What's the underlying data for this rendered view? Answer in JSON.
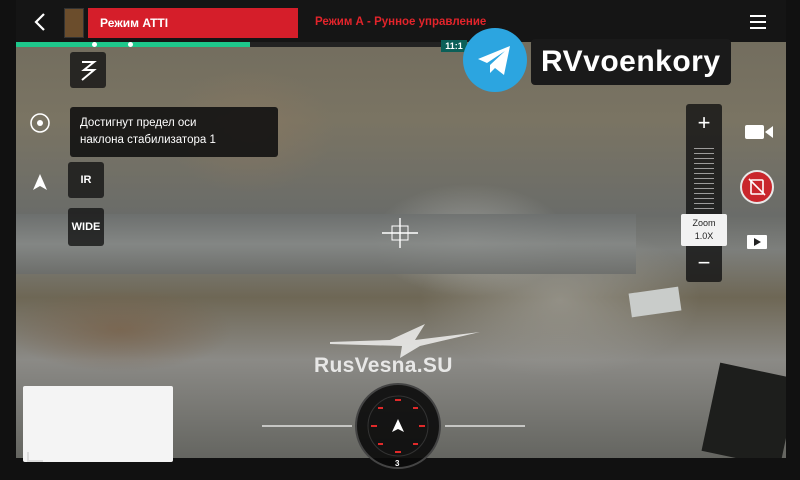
{
  "top_bar": {
    "mode_label": "Режим ATTI",
    "mode_description": "Режим А - Рунное управление"
  },
  "video": {
    "progress_percent": 55,
    "time_chip": "11:1"
  },
  "watermarks": {
    "telegram_channel": "RVvoenkory",
    "site": "RusVesna.SU"
  },
  "controls": {
    "ir_label": "IR",
    "wide_label": "WIDE",
    "zoom_plus": "+",
    "zoom_minus": "−",
    "zoom_title": "Zoom",
    "zoom_value": "1.0X"
  },
  "tooltip": {
    "line1": "Достигнут предел оси",
    "line2": "наклона стабилизатора 1"
  },
  "compass": {
    "heading_marker": "3"
  },
  "colors": {
    "mode_red": "#d51e2a",
    "progress_green": "#1ec78b",
    "telegram_blue": "#2ca5e0"
  }
}
